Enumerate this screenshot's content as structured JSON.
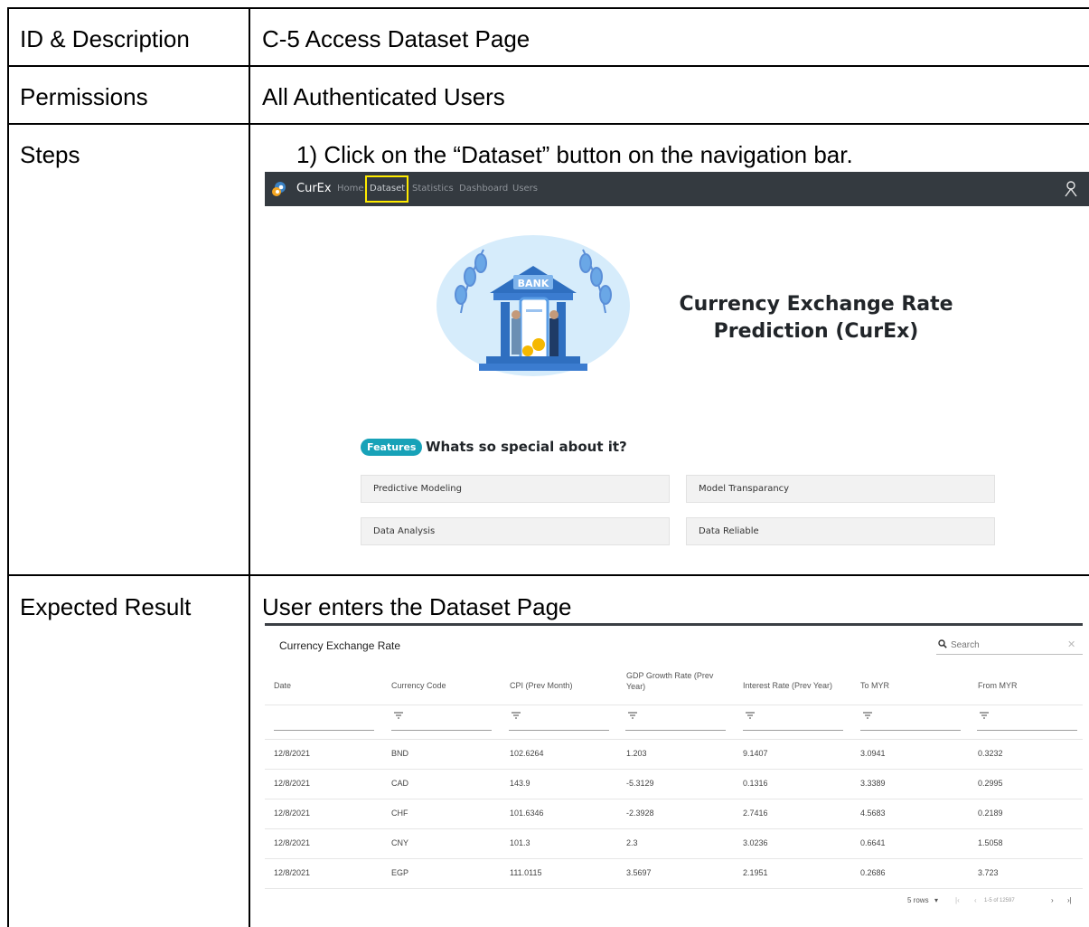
{
  "doc": {
    "rows": [
      {
        "label": "ID & Description",
        "value": "C-5 Access Dataset Page"
      },
      {
        "label": "Permissions",
        "value": "All Authenticated Users"
      },
      {
        "label": "Steps",
        "value": "1)  Click on the “Dataset” button on the navigation bar."
      },
      {
        "label": "Expected Result",
        "value": "User enters the Dataset Page"
      }
    ]
  },
  "home": {
    "brand": "CurEx",
    "nav": [
      "Home",
      "Dataset",
      "Statistics",
      "Dashboard",
      "Users"
    ],
    "hero_title_line1": "Currency Exchange Rate",
    "hero_title_line2": "Prediction (CurEx)",
    "bank_sign": "BANK",
    "features_badge": "Features",
    "features_heading": "Whats so special about it?",
    "features": [
      "Predictive Modeling",
      "Model Transparancy",
      "Data Analysis",
      "Data Reliable"
    ]
  },
  "dataset": {
    "title": "Currency Exchange Rate",
    "search_placeholder": "Search",
    "columns": [
      "Date",
      "Currency Code",
      "CPI (Prev Month)",
      "GDP Growth Rate (Prev Year)",
      "Interest Rate (Prev Year)",
      "To MYR",
      "From MYR"
    ],
    "rows": [
      [
        "12/8/2021",
        "BND",
        "102.6264",
        "1.203",
        "9.1407",
        "3.0941",
        "0.3232"
      ],
      [
        "12/8/2021",
        "CAD",
        "143.9",
        "-5.3129",
        "0.1316",
        "3.3389",
        "0.2995"
      ],
      [
        "12/8/2021",
        "CHF",
        "101.6346",
        "-2.3928",
        "2.7416",
        "4.5683",
        "0.2189"
      ],
      [
        "12/8/2021",
        "CNY",
        "101.3",
        "2.3",
        "3.0236",
        "0.6641",
        "1.5058"
      ],
      [
        "12/8/2021",
        "EGP",
        "111.0115",
        "3.5697",
        "2.1951",
        "0.2686",
        "3.723"
      ]
    ],
    "pager": {
      "rows_per_page": "5 rows",
      "range": "1-5 of 12597"
    }
  },
  "colors": {
    "navbar": "#343a40",
    "highlight": "#ffeb00",
    "badge": "#17a2b8"
  }
}
